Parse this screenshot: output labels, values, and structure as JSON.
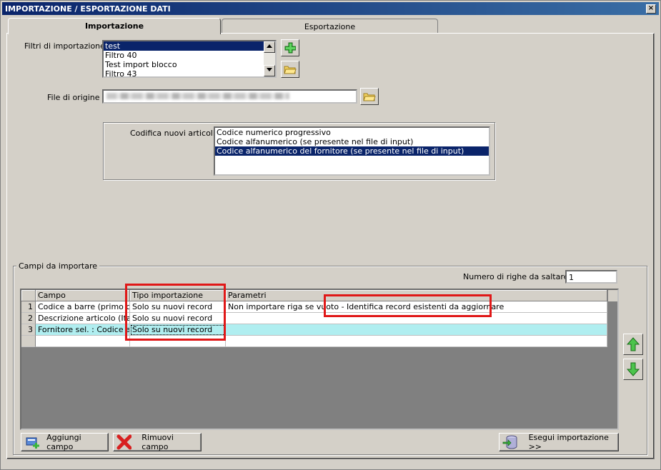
{
  "window": {
    "title": "IMPORTAZIONE / ESPORTAZIONE DATI",
    "close_glyph": "×"
  },
  "tabs": [
    {
      "label": "Importazione",
      "active": true
    },
    {
      "label": "Esportazione",
      "active": false
    }
  ],
  "filters": {
    "label": "Filtri di importazione :",
    "items": [
      "test",
      "Filtro 40",
      "Test import blocco",
      "Filtro 43"
    ],
    "selected_index": 0
  },
  "source_file": {
    "label": "File di origine :",
    "value": ""
  },
  "coding": {
    "label": "Codifica nuovi articoli :",
    "options": [
      "Codice numerico progressivo",
      "Codice alfanumerico (se presente nel file di input)",
      "Codice alfanumerico del fornitore (se presente nel file di input)"
    ],
    "selected_index": 2
  },
  "fields_group": {
    "title": "Campi da importare",
    "skip_rows_label": "Numero di righe da saltare :",
    "skip_rows_value": "1"
  },
  "grid": {
    "columns": [
      "Campo",
      "Tipo importazione",
      "Parametri"
    ],
    "rows": [
      {
        "num": "1",
        "campo": "Codice a barre (primo c...",
        "tipo": "Solo su nuovi record",
        "parametri": "Non importare riga se vuoto - Identifica record esistenti da aggiornare"
      },
      {
        "num": "2",
        "campo": "Descrizione articolo (Ital...",
        "tipo": "Solo su nuovi record",
        "parametri": ""
      },
      {
        "num": "3",
        "campo": "Fornitore sel. : Codice a...",
        "tipo": "Solo su nuovi record",
        "parametri": ""
      }
    ],
    "highlighted_row": 2
  },
  "buttons": {
    "add_field": "Aggiungi campo",
    "remove_field": "Rimuovi campo",
    "run_import": "Esegui importazione >>"
  },
  "colors": {
    "selection": "#0a246a",
    "highlight_row": "#b0eef0",
    "annotation_red": "#e01818",
    "add_green": "#3cb43c"
  }
}
